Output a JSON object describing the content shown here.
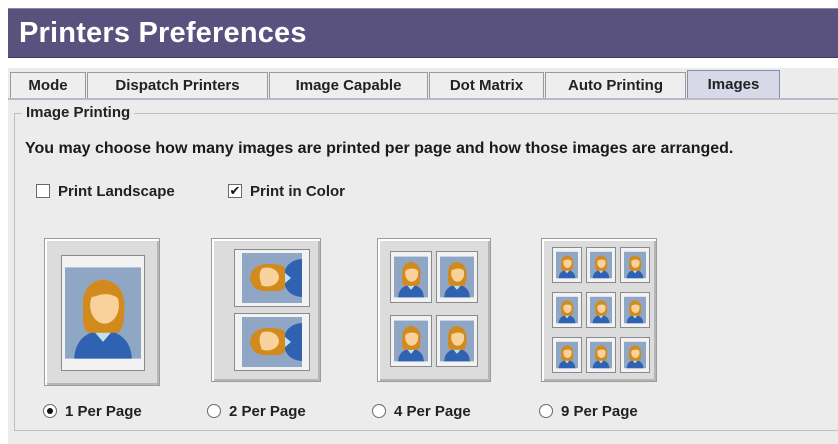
{
  "window": {
    "title": "Printers Preferences"
  },
  "tabs": [
    {
      "label": "Mode",
      "active": false
    },
    {
      "label": "Dispatch Printers",
      "active": false
    },
    {
      "label": "Image Capable",
      "active": false
    },
    {
      "label": "Dot Matrix",
      "active": false
    },
    {
      "label": "Auto Printing",
      "active": false
    },
    {
      "label": "Images",
      "active": true
    }
  ],
  "image_printing": {
    "group_title": "Image Printing",
    "description": "You may choose how many images are printed per page and how those images are arranged.",
    "options": [
      {
        "label": "Print Landscape",
        "checked": false
      },
      {
        "label": "Print in Color",
        "checked": true
      }
    ],
    "layouts": [
      {
        "label": "1 Per Page",
        "selected": true
      },
      {
        "label": "2 Per Page",
        "selected": false
      },
      {
        "label": "4 Per Page",
        "selected": false
      },
      {
        "label": "9 Per Page",
        "selected": false
      }
    ]
  },
  "icons": {
    "checkmark": "✔",
    "photo": "person-portrait-icon"
  },
  "colors": {
    "titlebar": "#5a527e",
    "active_tab": "#d8d9e8",
    "panel": "#ececec",
    "photo_bg": "#8fa6c4",
    "hair": "#d28a1c",
    "shirt": "#2f63b2"
  }
}
